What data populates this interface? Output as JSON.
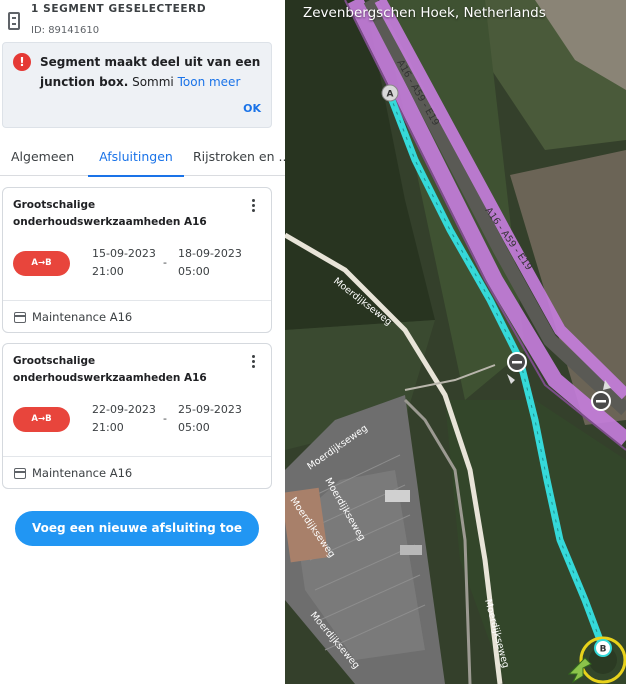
{
  "segment": {
    "title": "1 SEGMENT GESELECTEERD",
    "id": "ID: 89141610"
  },
  "alert": {
    "icon": "!",
    "text_bold": "Segment maakt deel uit van een junction box.",
    "text_rest": " Sommi",
    "link": "Toon meer",
    "ok": "OK"
  },
  "tabs": [
    {
      "label": "Algemeen",
      "active": false
    },
    {
      "label": "Afsluitingen",
      "active": true
    },
    {
      "label": "Rijstroken en ...",
      "active": false
    }
  ],
  "closures": [
    {
      "title": "Grootschalige onderhoudswerkzaamheden A16",
      "direction": "A→B",
      "start_date": "15-09-2023",
      "start_time": "21:00",
      "separator": "-",
      "end_date": "18-09-2023",
      "end_time": "05:00",
      "reason": "Maintenance A16"
    },
    {
      "title": "Grootschalige onderhoudswerkzaamheden A16",
      "direction": "A→B",
      "start_date": "22-09-2023",
      "start_time": "21:00",
      "separator": "-",
      "end_date": "25-09-2023",
      "end_time": "05:00",
      "reason": "Maintenance A16"
    }
  ],
  "add_button": "Voeg een nieuwe afsluiting toe",
  "map": {
    "location": "Zevenbergschen Hoek, Netherlands",
    "highway_label_1": "A16 - A59 - E19",
    "highway_label_2": "A16 - A59 - E19",
    "street_label_1": "Moerdijkseweg",
    "street_label_2": "Moerdijkseweg",
    "street_label_3": "Moerdijkseweg",
    "street_label_4": "Moerdijkseweg",
    "street_label_5": "Moerdijkseweg",
    "street_label_6": "Moerdijkseweg",
    "node_a": "A",
    "node_b": "B",
    "closure_icon": "minus-circle-icon",
    "colors": {
      "highway": "#c77dde",
      "segment": "#35d9d9",
      "road": "#f2efe6"
    }
  }
}
